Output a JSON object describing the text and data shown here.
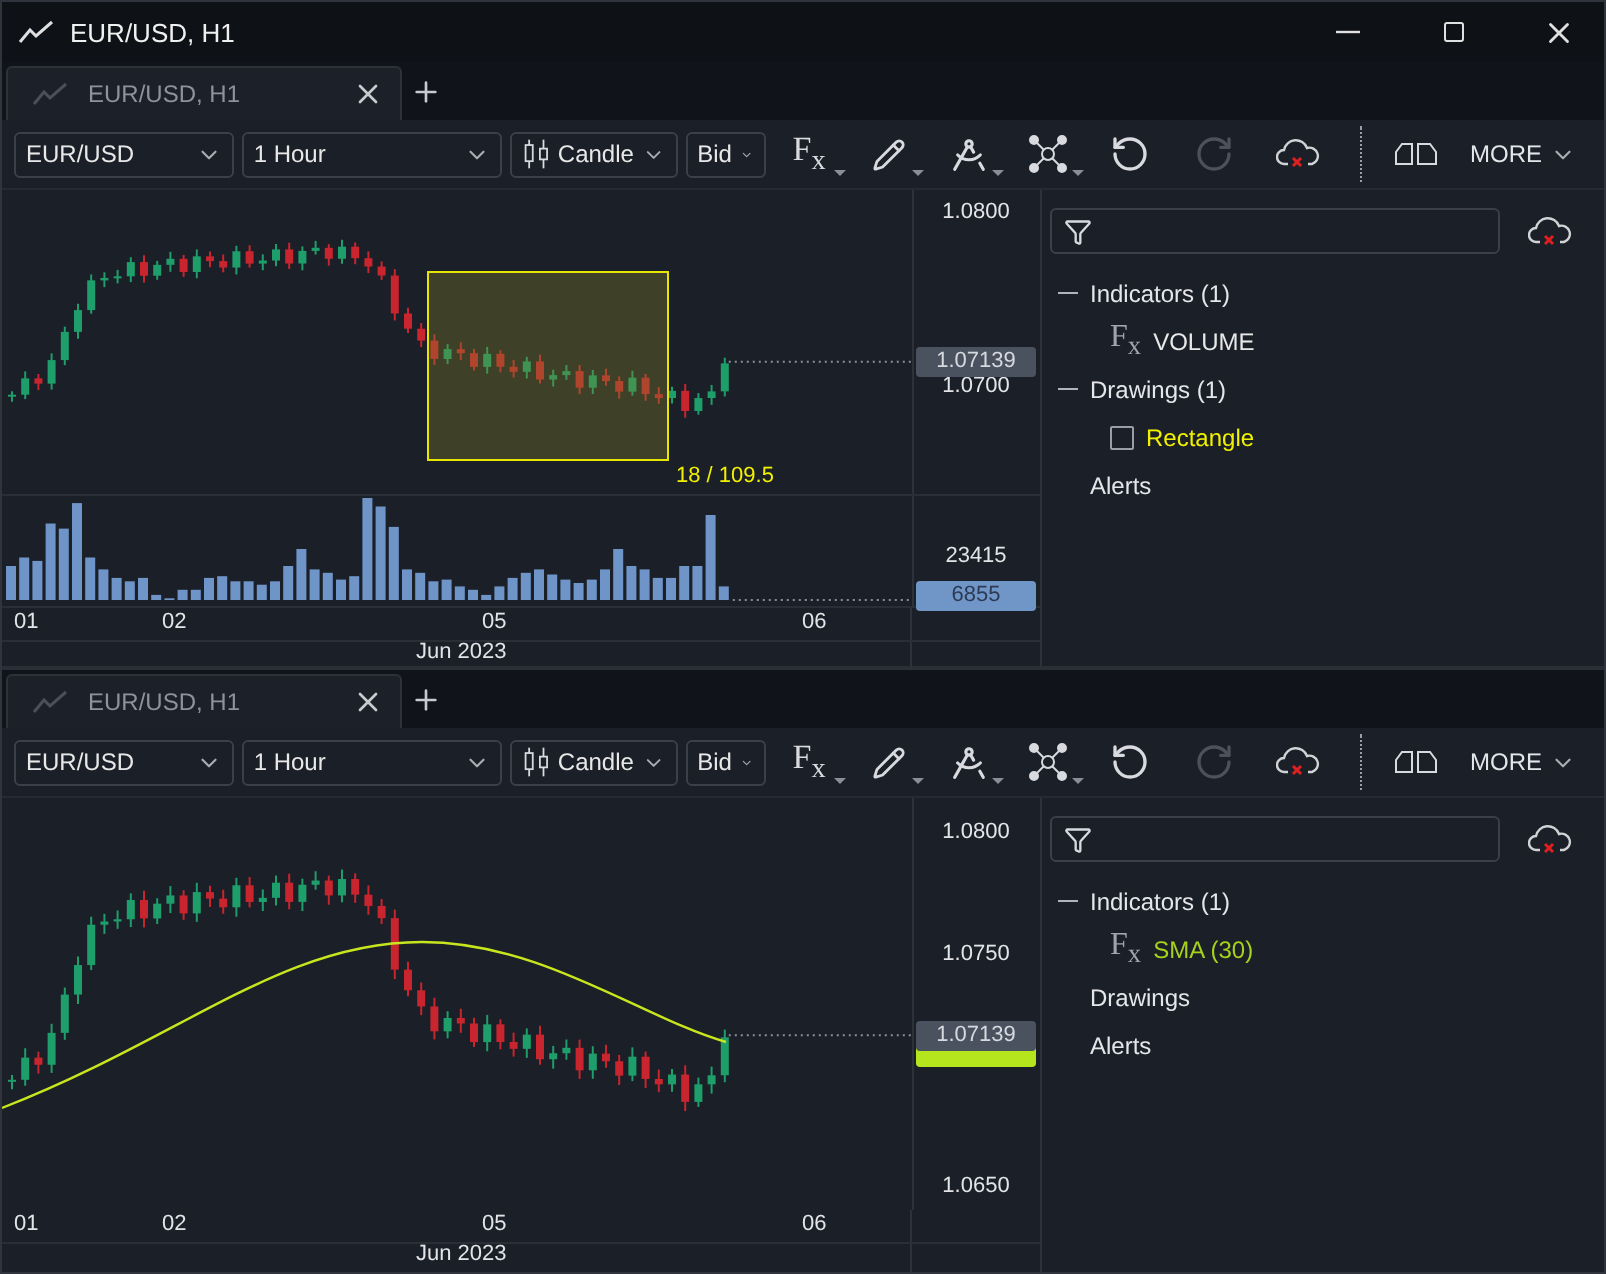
{
  "window": {
    "title": "EUR/USD, H1"
  },
  "panes": [
    {
      "tabs": [
        {
          "label": "EUR/USD, H1",
          "selected": true
        }
      ],
      "toolbar": {
        "symbol": "EUR/USD",
        "timeframe": "1 Hour",
        "chart_type": "Candle",
        "price_side": "Bid",
        "indicators_glyph": "F$_{x}$",
        "redo": {
          "disabled": true
        },
        "more": "MORE"
      },
      "chart": {
        "price_ticks": [
          "1.0800",
          "1.0700"
        ],
        "last_price": "1.07139",
        "rectangle": {
          "label": "18 / 109.5"
        },
        "volume": {
          "tick": "23415",
          "last": "6855"
        },
        "date_ticks": [
          "01",
          "02",
          "05",
          "06"
        ],
        "month": "Jun 2023"
      },
      "tree": [
        {
          "label": "Indicators (1)",
          "expanded": true,
          "children": [
            {
              "kind": "indicator",
              "glyph": "F$_{x}$",
              "label": "VOLUME",
              "color": "#e8e8e8"
            }
          ]
        },
        {
          "label": "Drawings (1)",
          "expanded": true,
          "children": [
            {
              "kind": "drawing",
              "label": "Rectangle",
              "color": "#f0f000",
              "checked": false
            }
          ]
        },
        {
          "label": "Alerts"
        }
      ]
    },
    {
      "tabs": [
        {
          "label": "EUR/USD, H1",
          "selected": true
        }
      ],
      "toolbar": {
        "symbol": "EUR/USD",
        "timeframe": "1 Hour",
        "chart_type": "Candle",
        "price_side": "Bid",
        "indicators_glyph": "F$_{x}$",
        "redo": {
          "disabled": true
        },
        "more": "MORE"
      },
      "chart": {
        "price_ticks": [
          "1.0800",
          "1.0750",
          "1.0650"
        ],
        "last_price": "1.07139",
        "sma_line": true,
        "date_ticks": [
          "01",
          "02",
          "05",
          "06"
        ],
        "month": "Jun 2023"
      },
      "tree": [
        {
          "label": "Indicators (1)",
          "expanded": true,
          "children": [
            {
              "kind": "indicator",
              "glyph": "F$_{x}$",
              "label": "SMA (30)",
              "color": "#a6d21e"
            }
          ]
        },
        {
          "label": "Drawings"
        },
        {
          "label": "Alerts"
        }
      ]
    }
  ]
}
